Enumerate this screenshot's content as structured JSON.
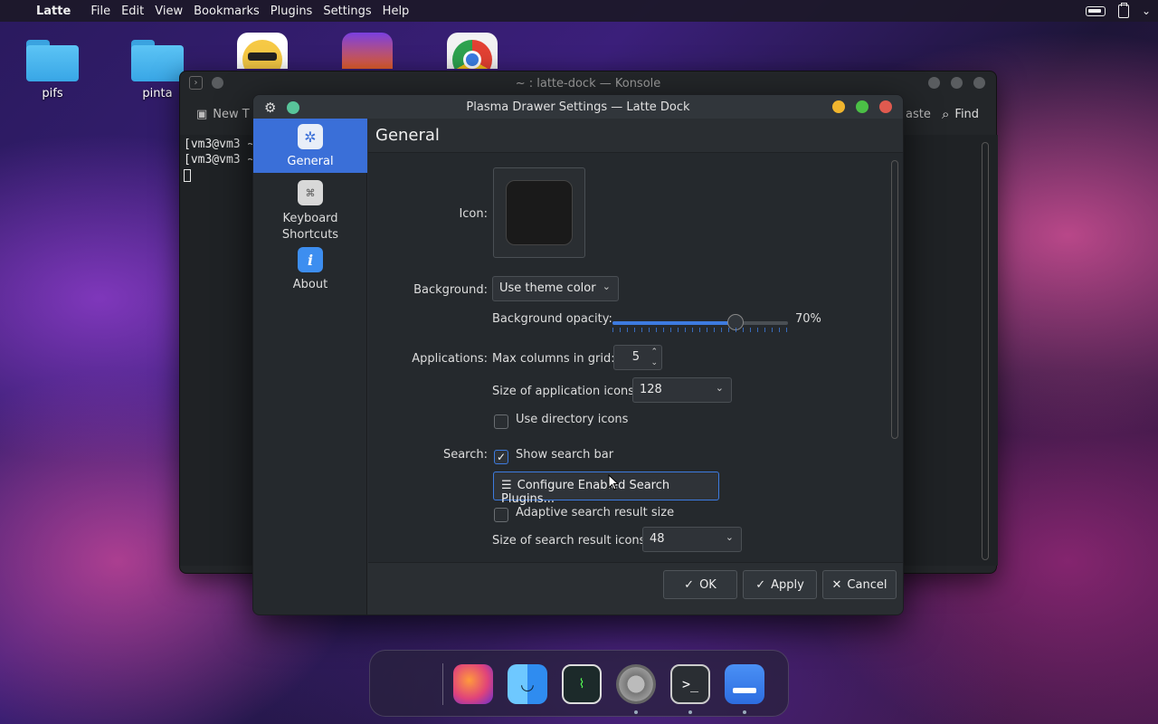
{
  "menubar": {
    "app_name": "Latte",
    "items": [
      "File",
      "Edit",
      "View",
      "Bookmarks",
      "Plugins",
      "Settings",
      "Help"
    ]
  },
  "desktop": {
    "icons": [
      {
        "label": "pifs",
        "icon": "folder-icon"
      },
      {
        "label": "pinta",
        "icon": "folder-icon"
      }
    ]
  },
  "konsole": {
    "title": "~ : latte-dock — Konsole",
    "new_tab_label": "New T",
    "paste_label": "aste",
    "find_label": "Find",
    "lines": [
      "[vm3@vm3 ~",
      "[vm3@vm3 ~"
    ]
  },
  "dialog": {
    "title": "Plasma Drawer Settings — Latte Dock",
    "sidebar": [
      {
        "label": "General",
        "icon": "settings-icon"
      },
      {
        "label": "Keyboard\nShortcuts",
        "icon": "keyboard-icon"
      },
      {
        "label": "About",
        "icon": "info-icon"
      }
    ],
    "heading": "General",
    "icon_label": "Icon:",
    "background_label": "Background:",
    "background_value": "Use theme color",
    "background_opacity_label": "Background opacity:",
    "background_opacity_value": "70%",
    "background_opacity": 0.7,
    "applications_label": "Applications:",
    "max_columns_label": "Max columns in grid:",
    "max_columns_value": "5",
    "app_icon_size_label": "Size of application icons:",
    "app_icon_size_value": "128",
    "use_directory_icons_label": "Use directory icons",
    "use_directory_icons_checked": false,
    "search_label": "Search:",
    "show_search_bar_label": "Show search bar",
    "show_search_bar_checked": true,
    "configure_plugins_label": "Configure Enabled Search Plugins...",
    "adaptive_search_label": "Adaptive search result size",
    "adaptive_search_checked": false,
    "search_icon_size_label": "Size of search result icons:",
    "search_icon_size_value": "48",
    "ok_label": "OK",
    "apply_label": "Apply",
    "cancel_label": "Cancel"
  },
  "colors": {
    "accent": "#3d7be0",
    "sidebar_active": "#3a6fd8",
    "close": "#e05a4f",
    "minimize": "#f0b52e",
    "maximize": "#4bbf46",
    "keep_above": "#58c49a"
  },
  "dock": {
    "items": [
      "apple-launcher-icon",
      "firefox-icon",
      "finder-icon",
      "system-monitor-icon",
      "system-settings-icon",
      "terminal-icon",
      "latte-icon"
    ]
  }
}
